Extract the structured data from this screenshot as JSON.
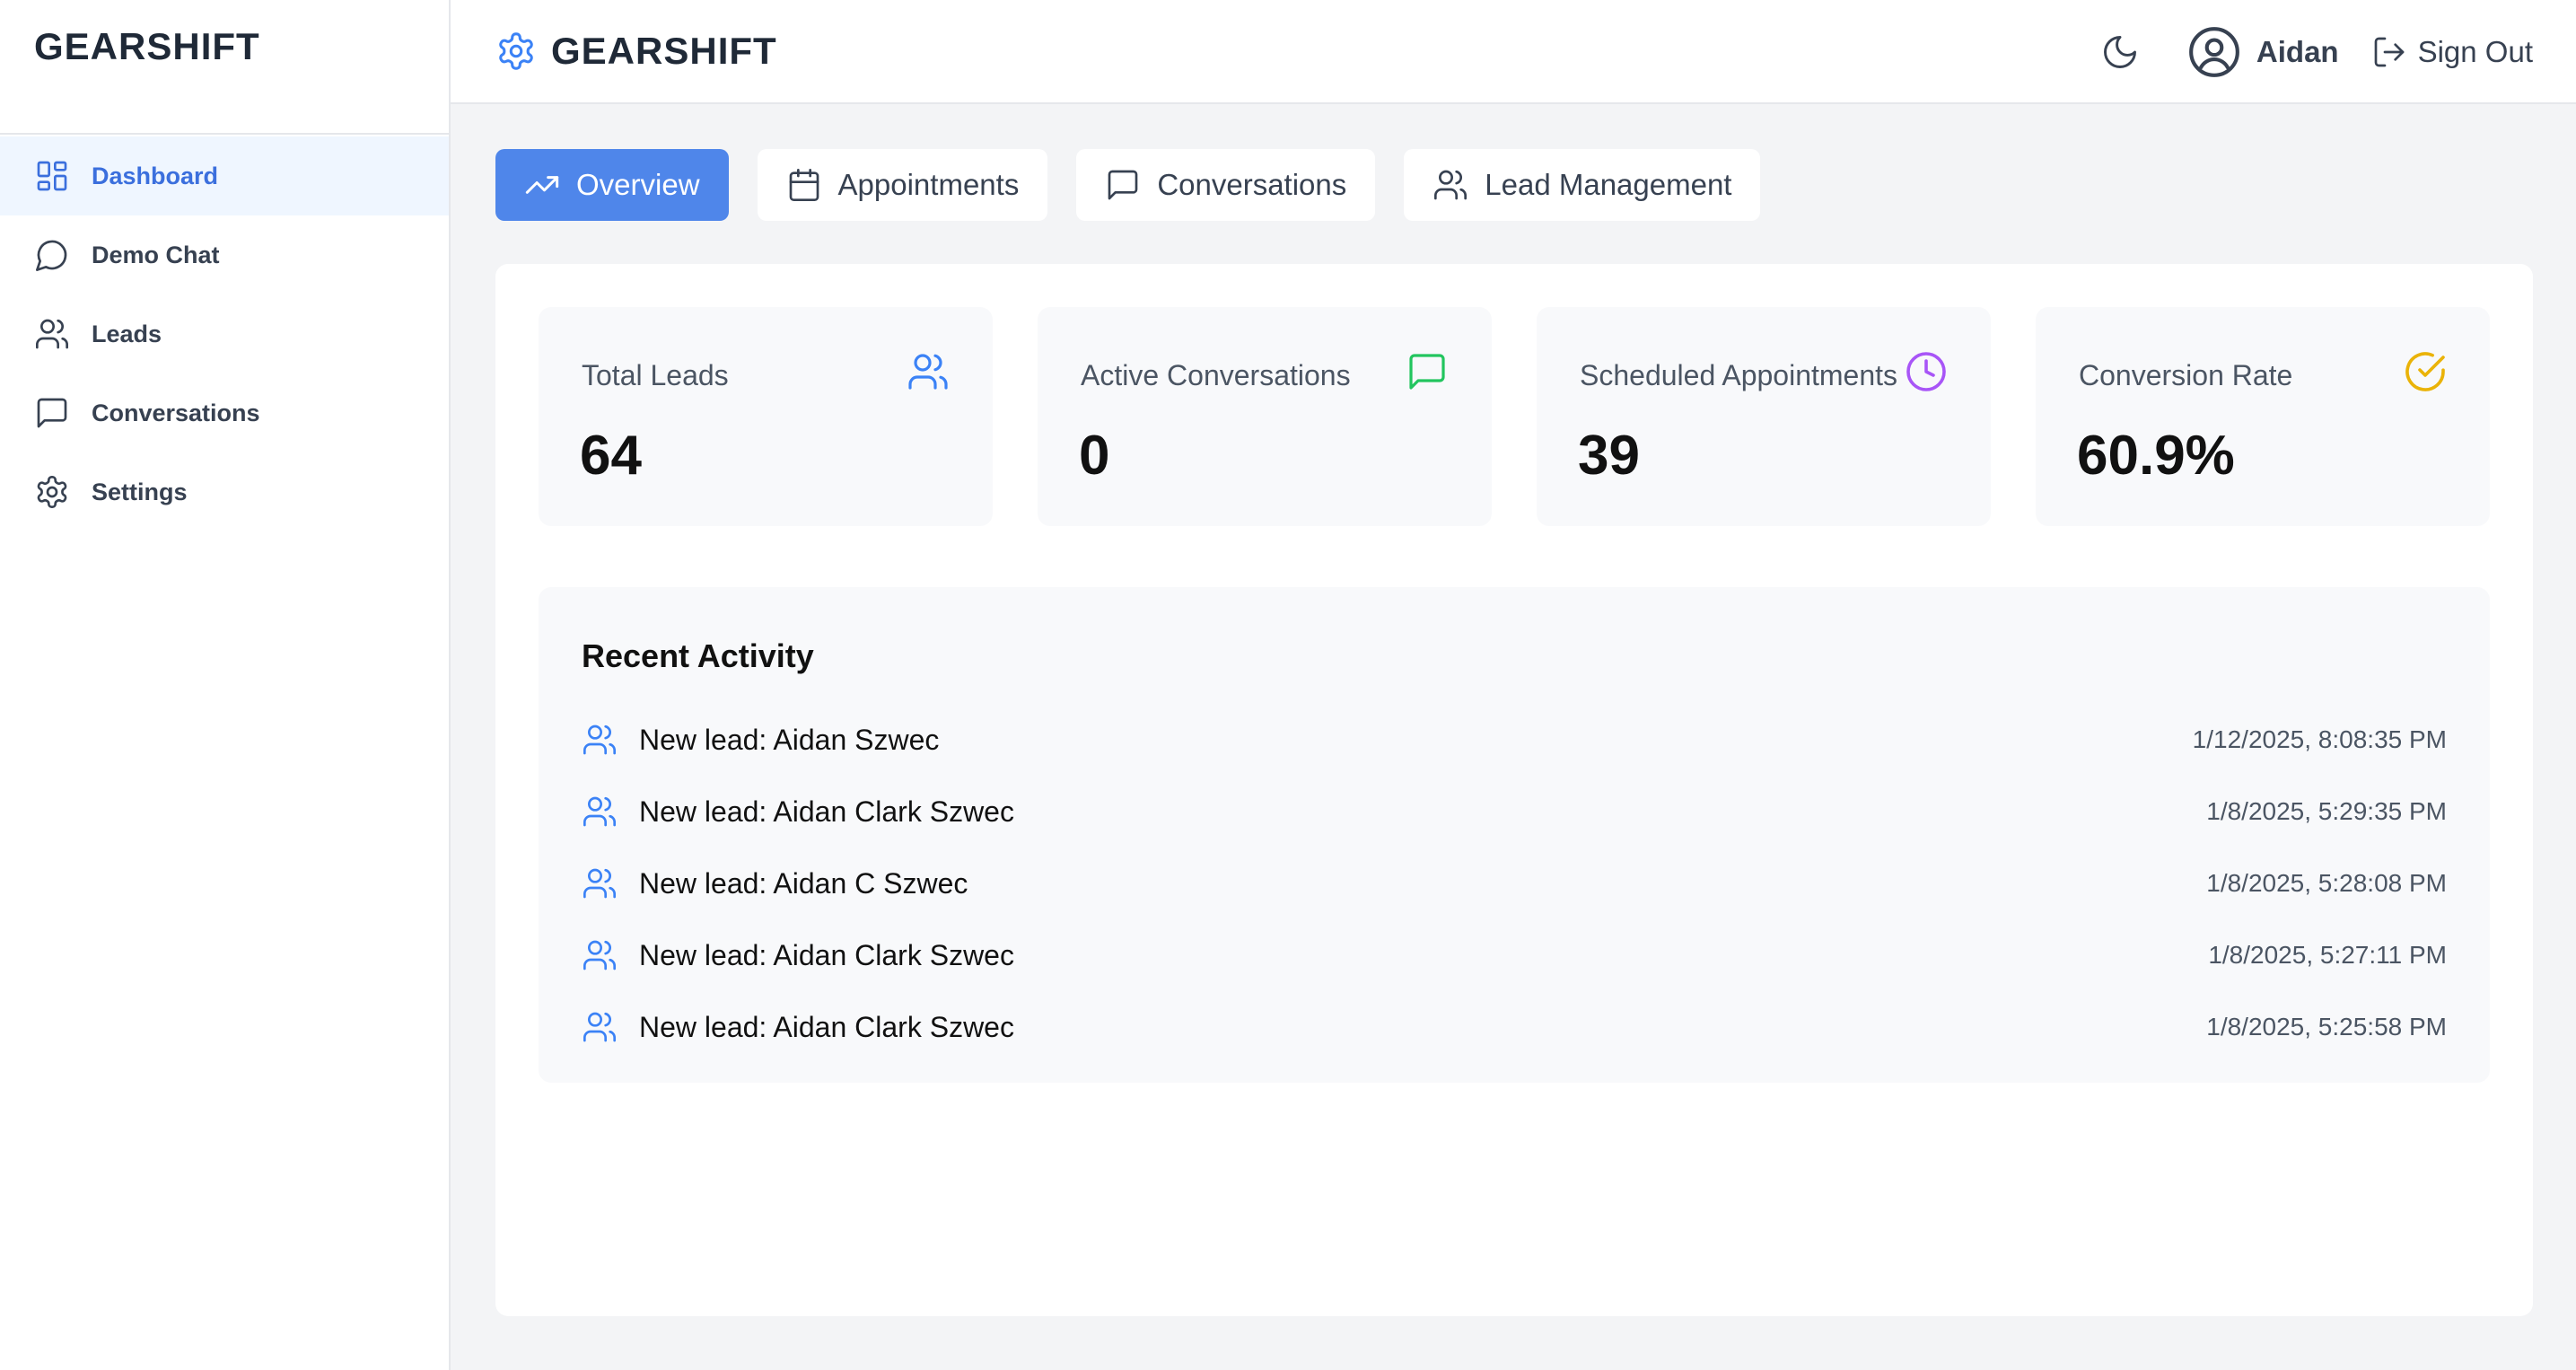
{
  "sidebar": {
    "brand": "GEARSHIFT",
    "items": [
      {
        "label": "Dashboard",
        "icon": "dashboard-icon"
      },
      {
        "label": "Demo Chat",
        "icon": "chat-bubble-icon"
      },
      {
        "label": "Leads",
        "icon": "users-icon"
      },
      {
        "label": "Conversations",
        "icon": "message-square-icon"
      },
      {
        "label": "Settings",
        "icon": "gear-icon"
      }
    ],
    "active_index": 0
  },
  "header": {
    "title": "GEARSHIFT",
    "logo_icon": "gear-icon",
    "theme_icon": "moon-icon",
    "user_name": "Aidan",
    "sign_out": "Sign Out"
  },
  "tabs": [
    {
      "label": "Overview",
      "icon": "trending-up-icon"
    },
    {
      "label": "Appointments",
      "icon": "calendar-icon"
    },
    {
      "label": "Conversations",
      "icon": "message-square-icon"
    },
    {
      "label": "Lead Management",
      "icon": "users-icon"
    }
  ],
  "stats": [
    {
      "label": "Total Leads",
      "value": "64",
      "icon": "users-icon",
      "color": "#3b82f6"
    },
    {
      "label": "Active Conversations",
      "value": "0",
      "icon": "message-square-icon",
      "color": "#22c55e"
    },
    {
      "label": "Scheduled Appointments",
      "value": "39",
      "icon": "clock-icon",
      "color": "#a855f7"
    },
    {
      "label": "Conversion Rate",
      "value": "60.9%",
      "icon": "check-circle-icon",
      "color": "#eab308"
    }
  ],
  "activity": {
    "title": "Recent Activity",
    "items": [
      {
        "text": "New lead: Aidan Szwec",
        "time": "1/12/2025, 8:08:35 PM"
      },
      {
        "text": "New lead: Aidan Clark Szwec",
        "time": "1/8/2025, 5:29:35 PM"
      },
      {
        "text": "New lead: Aidan C Szwec",
        "time": "1/8/2025, 5:28:08 PM"
      },
      {
        "text": "New lead: Aidan Clark Szwec",
        "time": "1/8/2025, 5:27:11 PM"
      },
      {
        "text": "New lead: Aidan Clark Szwec",
        "time": "1/8/2025, 5:25:58 PM"
      }
    ]
  },
  "colors": {
    "accent": "#4f86ea",
    "active_nav_bg": "#eff6ff",
    "page_bg": "#f3f4f6"
  }
}
